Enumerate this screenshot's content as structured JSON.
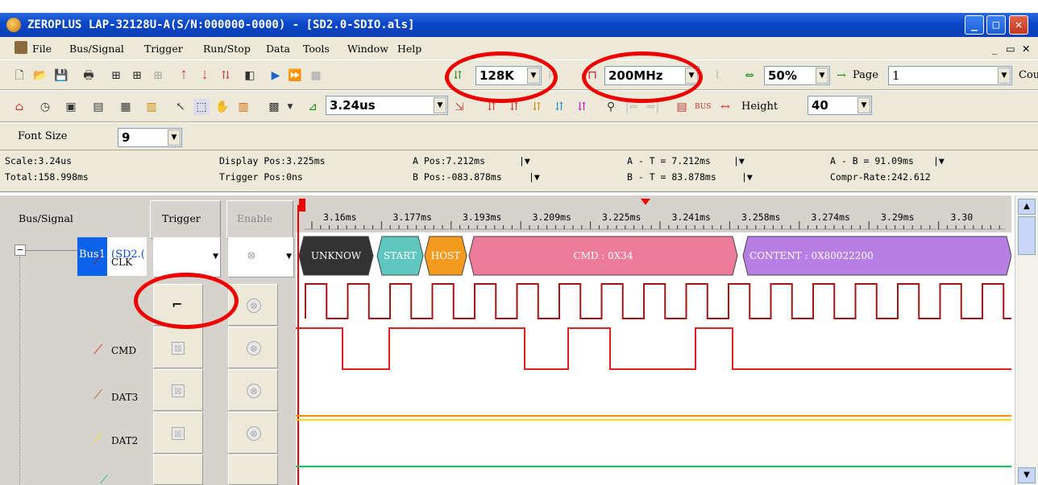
{
  "window": {
    "title": "ZEROPLUS LAP-32128U-A(S/N:000000-0000) - [SD2.0-SDIO.als]"
  },
  "menu": [
    "File",
    "Bus/Signal",
    "Trigger",
    "Run/Stop",
    "Data",
    "Tools",
    "Window",
    "Help"
  ],
  "toolbar": {
    "memory_depth": "128K",
    "sample_rate": "200MHz",
    "zoom": "50%",
    "page_label": "Page",
    "page_value": "1",
    "count_label": "Cou",
    "scale": "3.24us",
    "height_label": "Height",
    "height_value": "40",
    "font_size_label": "Font Size",
    "font_size_value": "9"
  },
  "info": {
    "scale": "Scale:3.24us",
    "total": "Total:158.998ms",
    "display_pos": "Display Pos:3.225ms",
    "trigger_pos": "Trigger Pos:0ns",
    "a_pos": "A Pos:7.212ms",
    "b_pos": "B Pos:-083.878ms",
    "a_t": "A - T = 7.212ms",
    "b_t": "B - T = 83.878ms",
    "a_b": "A - B = 91.09ms",
    "compr_rate": "Compr-Rate:242.612"
  },
  "panel": {
    "bus_signal_header": "Bus/Signal",
    "trigger_header": "Trigger",
    "enable_header": "Enable",
    "bus_name": "Bus1",
    "bus_suffix": "(SD2.(",
    "signals": [
      "CLK",
      "CMD",
      "DAT3",
      "DAT2"
    ]
  },
  "timeline": {
    "ticks": [
      "3.16ms",
      "3.177ms",
      "3.193ms",
      "3.209ms",
      "3.225ms",
      "3.241ms",
      "3.258ms",
      "3.274ms",
      "3.29ms",
      "3.30"
    ]
  },
  "decode": [
    {
      "label": "UNKNOW",
      "color": "#333333"
    },
    {
      "label": "START",
      "color": "#5fc7c0"
    },
    {
      "label": "HOST",
      "color": "#f39a1f"
    },
    {
      "label": "CMD : 0X34",
      "color": "#ee7b9a"
    },
    {
      "label": "CONTENT : 0X80022200",
      "color": "#b77fe6"
    }
  ],
  "colors": {
    "clk": "#a31515",
    "cmd": "#e02020",
    "dat3": "#ff8c00",
    "dat2": "#00cc55",
    "titlebar": "#0a46c8"
  }
}
